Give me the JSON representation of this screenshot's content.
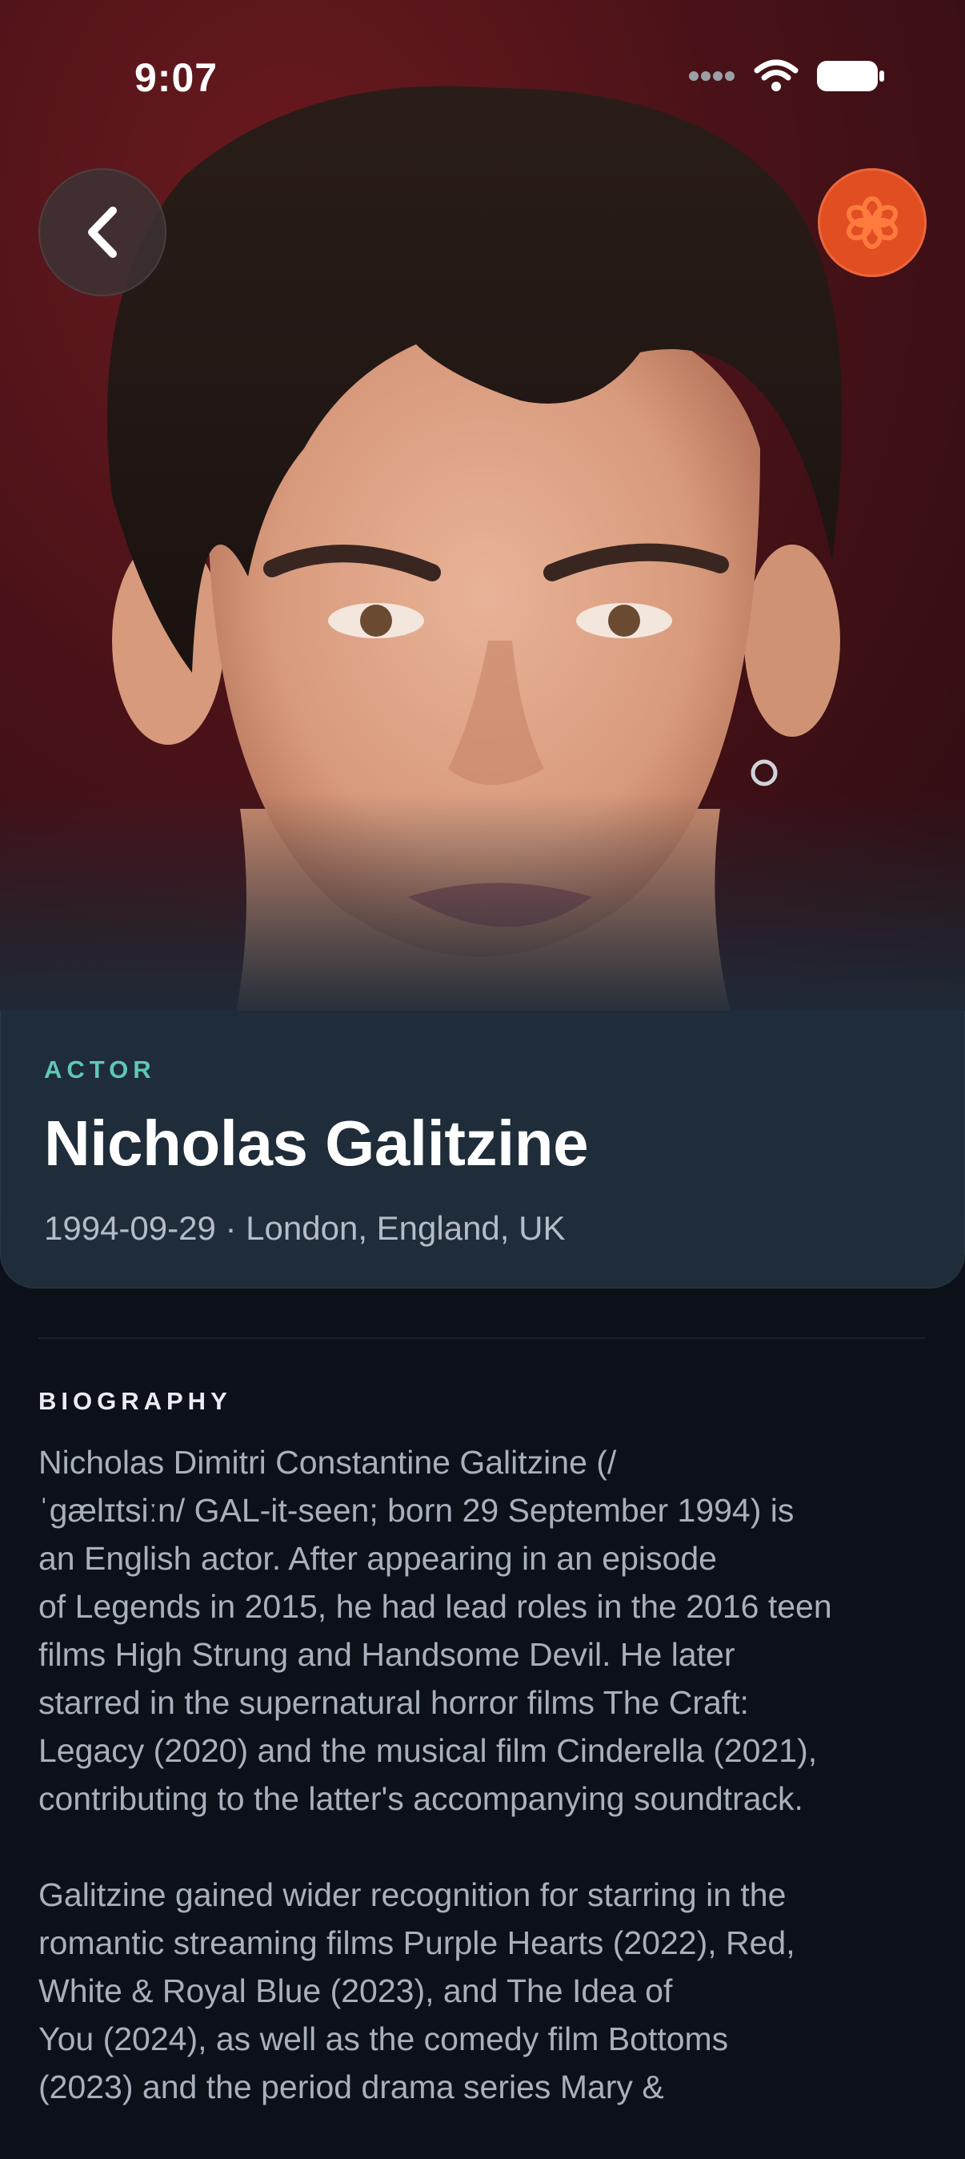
{
  "status_bar": {
    "time": "9:07"
  },
  "header": {
    "back_icon": "chevron-left-icon",
    "tmdb_icon": "flower-icon",
    "accent": "#e04e21"
  },
  "person": {
    "role": "ACTOR",
    "name": "Nicholas Galitzine",
    "meta": "1994-09-29 · London, England, UK"
  },
  "biography": {
    "heading": "BIOGRAPHY",
    "paragraphs": [
      "Nicholas Dimitri Constantine Galitzine (/\nˈɡælɪtsiːn/ GAL-it-seen; born 29 September 1994) is\nan English actor. After appearing in an episode\nof Legends in 2015, he had lead roles in the 2016 teen\nfilms High Strung and Handsome Devil. He later\nstarred in the supernatural horror films The Craft:\nLegacy (2020) and the musical film Cinderella (2021),\ncontributing to the latter's accompanying soundtrack.",
      "Galitzine gained wider recognition for starring in the\nromantic streaming films Purple Hearts (2022), Red,\nWhite & Royal Blue (2023), and The Idea of\nYou (2024), as well as the comedy film Bottoms\n(2023) and the period drama series Mary &"
    ]
  },
  "colors": {
    "role_accent": "#5fc7b5",
    "card_bg": "#1f2c3a",
    "page_bg": "#0c1019"
  }
}
